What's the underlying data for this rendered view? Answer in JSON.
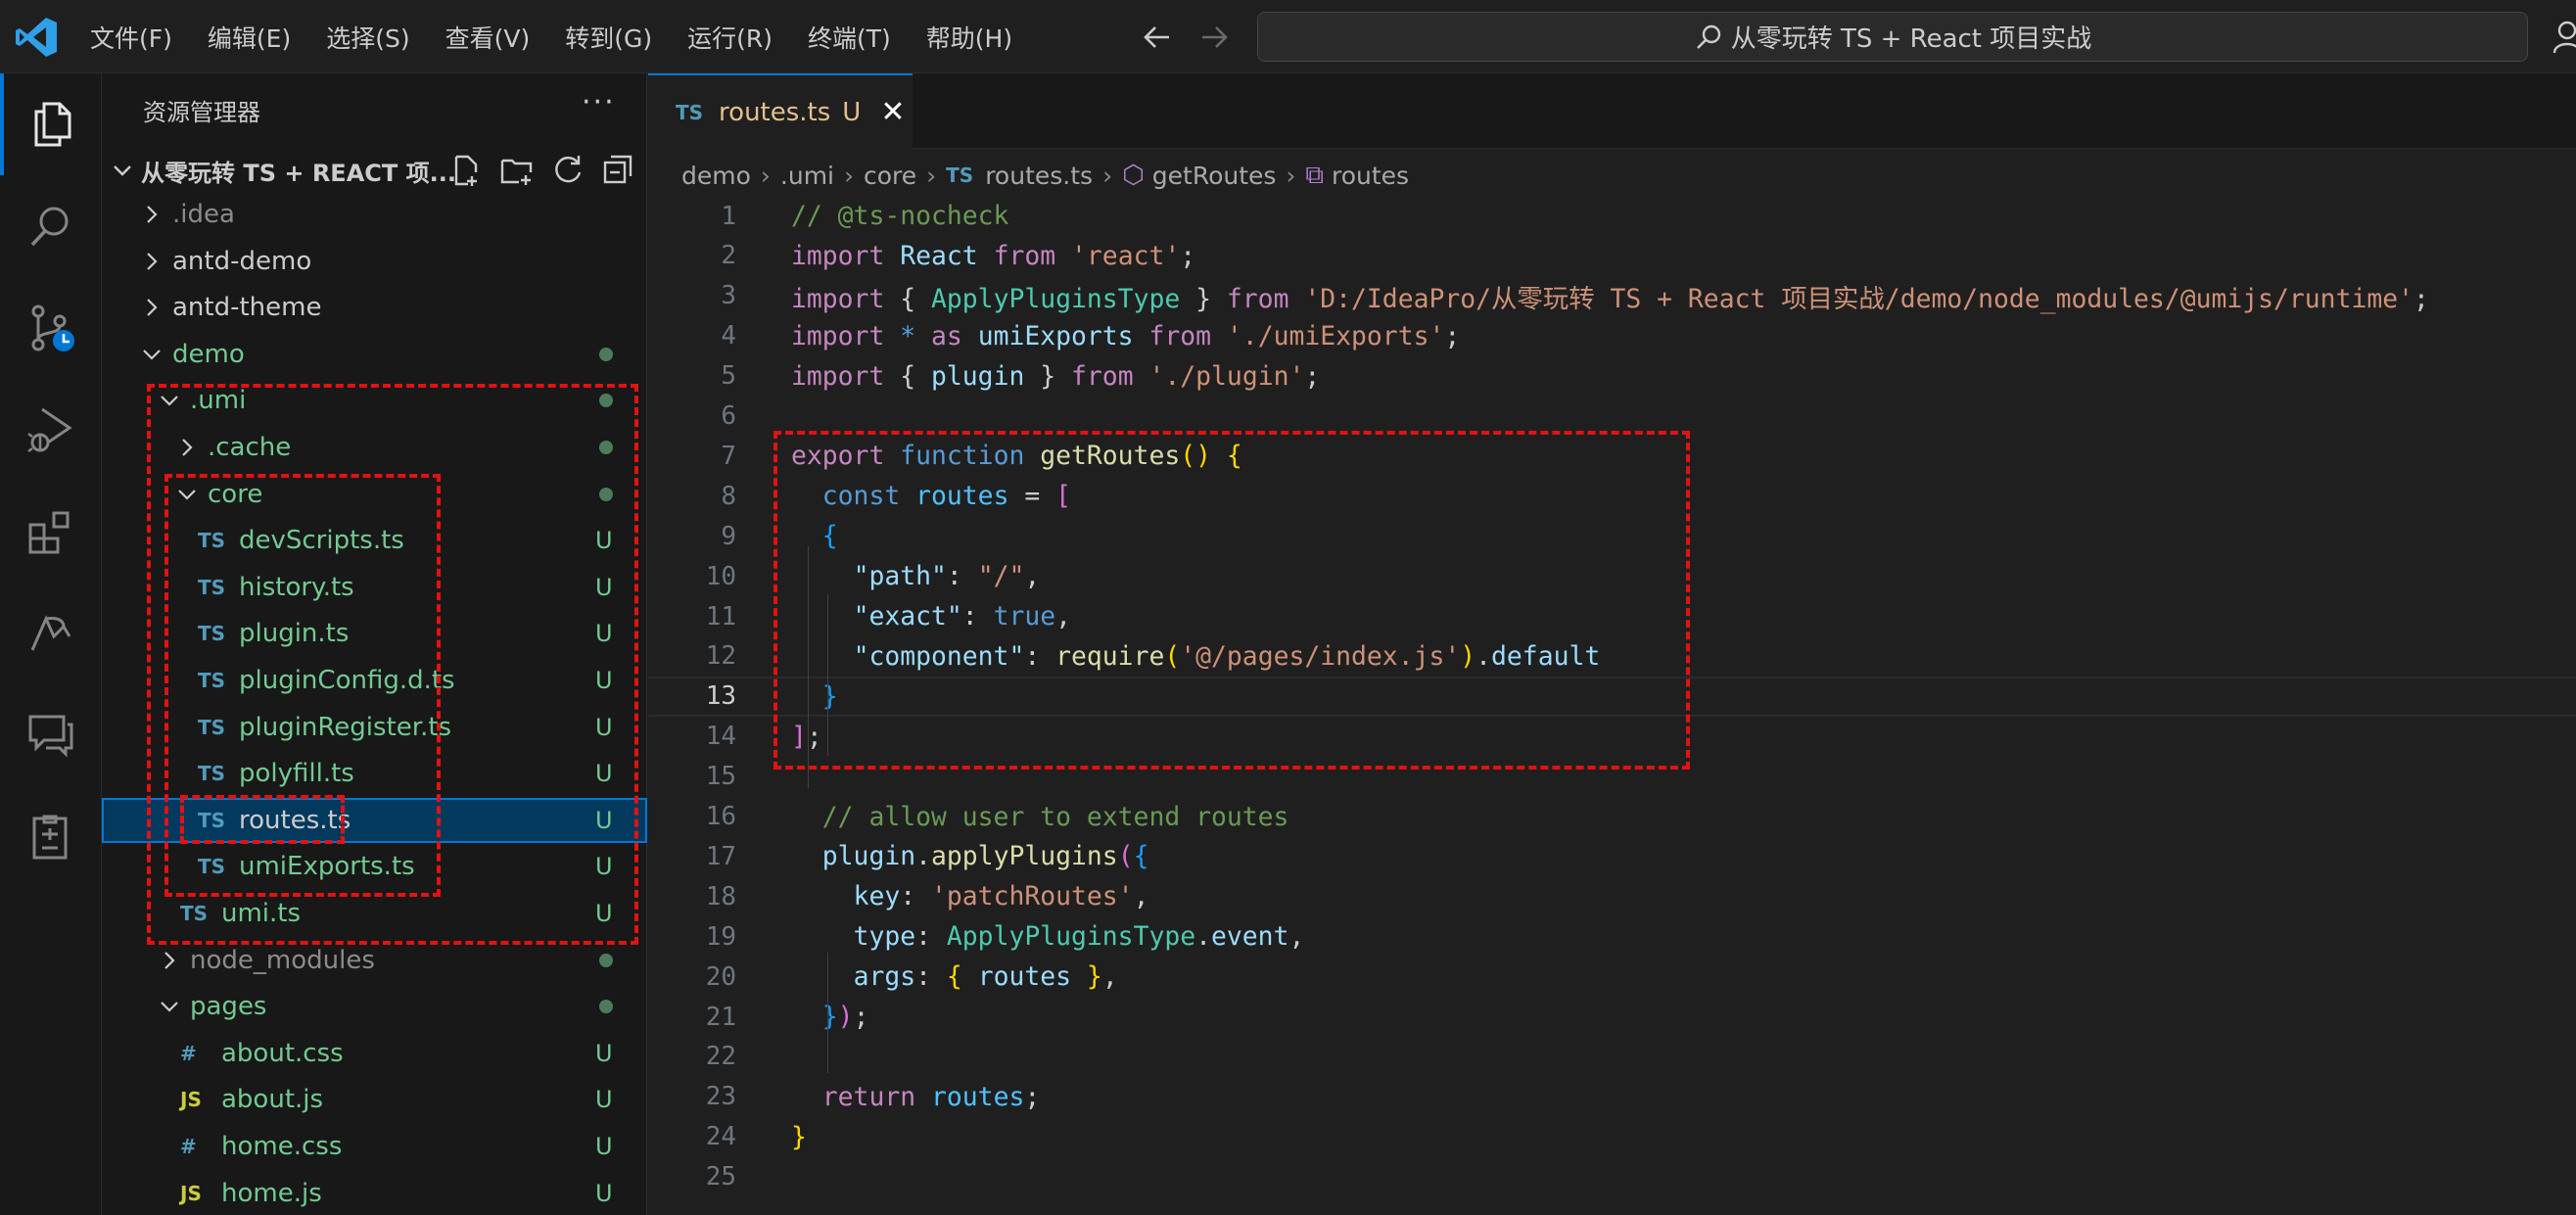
{
  "menu": [
    "文件(F)",
    "编辑(E)",
    "选择(S)",
    "查看(V)",
    "转到(G)",
    "运行(R)",
    "终端(T)",
    "帮助(H)"
  ],
  "search": {
    "text": "从零玩转 TS + React 项目实战"
  },
  "explorer": {
    "title": "资源管理器",
    "more": "···",
    "project": "从零玩转 TS + REACT 项...",
    "items": [
      {
        "name": ".idea",
        "type": "folder",
        "open": false,
        "indent": 0,
        "color": "grey",
        "status": ""
      },
      {
        "name": "antd-demo",
        "type": "folder",
        "open": false,
        "indent": 0,
        "color": "white",
        "status": ""
      },
      {
        "name": "antd-theme",
        "type": "folder",
        "open": false,
        "indent": 0,
        "color": "white",
        "status": ""
      },
      {
        "name": "demo",
        "type": "folder",
        "open": true,
        "indent": 0,
        "color": "green",
        "status": "dot"
      },
      {
        "name": ".umi",
        "type": "folder",
        "open": true,
        "indent": 1,
        "color": "green",
        "status": "dot"
      },
      {
        "name": ".cache",
        "type": "folder",
        "open": false,
        "indent": 2,
        "color": "green",
        "status": "dot"
      },
      {
        "name": "core",
        "type": "folder",
        "open": true,
        "indent": 2,
        "color": "green",
        "status": "dot"
      },
      {
        "name": "devScripts.ts",
        "type": "ts",
        "indent": 3,
        "color": "green",
        "status": "U"
      },
      {
        "name": "history.ts",
        "type": "ts",
        "indent": 3,
        "color": "green",
        "status": "U"
      },
      {
        "name": "plugin.ts",
        "type": "ts",
        "indent": 3,
        "color": "green",
        "status": "U"
      },
      {
        "name": "pluginConfig.d.ts",
        "type": "ts",
        "indent": 3,
        "color": "green",
        "status": "U"
      },
      {
        "name": "pluginRegister.ts",
        "type": "ts",
        "indent": 3,
        "color": "green",
        "status": "U"
      },
      {
        "name": "polyfill.ts",
        "type": "ts",
        "indent": 3,
        "color": "green",
        "status": "U"
      },
      {
        "name": "routes.ts",
        "type": "ts",
        "indent": 3,
        "color": "white",
        "status": "U",
        "selected": true
      },
      {
        "name": "umiExports.ts",
        "type": "ts",
        "indent": 3,
        "color": "green",
        "status": "U"
      },
      {
        "name": "umi.ts",
        "type": "ts",
        "indent": 2,
        "color": "green",
        "status": "U"
      },
      {
        "name": "node_modules",
        "type": "folder",
        "open": false,
        "indent": 1,
        "color": "grey",
        "status": "dot"
      },
      {
        "name": "pages",
        "type": "folder",
        "open": true,
        "indent": 1,
        "color": "green",
        "status": "dot"
      },
      {
        "name": "about.css",
        "type": "css",
        "indent": 2,
        "color": "green",
        "status": "U"
      },
      {
        "name": "about.js",
        "type": "js",
        "indent": 2,
        "color": "green",
        "status": "U"
      },
      {
        "name": "home.css",
        "type": "css",
        "indent": 2,
        "color": "green",
        "status": "U"
      },
      {
        "name": "home.js",
        "type": "js",
        "indent": 2,
        "color": "green",
        "status": "U"
      }
    ]
  },
  "tab": {
    "icon": "TS",
    "name": "routes.ts",
    "status": "U",
    "close": "✕"
  },
  "breadcrumb": [
    "demo",
    ".umi",
    "core",
    "routes.ts",
    "getRoutes",
    "routes"
  ],
  "code": [
    [
      [
        "cm",
        "// @ts-nocheck"
      ]
    ],
    [
      [
        "kc",
        "import "
      ],
      [
        "v",
        "React "
      ],
      [
        "kc",
        "from "
      ],
      [
        "s",
        "'react'"
      ],
      [
        "p",
        ";"
      ]
    ],
    [
      [
        "kc",
        "import "
      ],
      [
        "p",
        "{ "
      ],
      [
        "t",
        "ApplyPluginsType "
      ],
      [
        "p",
        "} "
      ],
      [
        "kc",
        "from "
      ],
      [
        "s",
        "'D:/IdeaPro/从零玩转 TS + React 项目实战/demo/node_modules/@umijs/runtime'"
      ],
      [
        "p",
        ";"
      ]
    ],
    [
      [
        "kc",
        "import "
      ],
      [
        "k",
        "* "
      ],
      [
        "kc",
        "as "
      ],
      [
        "v",
        "umiExports "
      ],
      [
        "kc",
        "from "
      ],
      [
        "s",
        "'./umiExports'"
      ],
      [
        "p",
        ";"
      ]
    ],
    [
      [
        "kc",
        "import "
      ],
      [
        "p",
        "{ "
      ],
      [
        "v",
        "plugin "
      ],
      [
        "p",
        "} "
      ],
      [
        "kc",
        "from "
      ],
      [
        "s",
        "'./plugin'"
      ],
      [
        "p",
        ";"
      ]
    ],
    [],
    [
      [
        "kc",
        "export "
      ],
      [
        "k",
        "function "
      ],
      [
        "f",
        "getRoutes"
      ],
      [
        "b1",
        "() {"
      ]
    ],
    [
      [
        "p",
        "  "
      ],
      [
        "k",
        "const "
      ],
      [
        "cn",
        "routes "
      ],
      [
        "p",
        "= "
      ],
      [
        "b2",
        "["
      ]
    ],
    [
      [
        "p",
        "  "
      ],
      [
        "b3",
        "{"
      ]
    ],
    [
      [
        "p",
        "    "
      ],
      [
        "v",
        "\"path\""
      ],
      [
        "p",
        ": "
      ],
      [
        "s",
        "\"/\""
      ],
      [
        "p",
        ","
      ]
    ],
    [
      [
        "p",
        "    "
      ],
      [
        "v",
        "\"exact\""
      ],
      [
        "p",
        ": "
      ],
      [
        "k",
        "true"
      ],
      [
        "p",
        ","
      ]
    ],
    [
      [
        "p",
        "    "
      ],
      [
        "v",
        "\"component\""
      ],
      [
        "p",
        ": "
      ],
      [
        "f",
        "require"
      ],
      [
        "b1",
        "("
      ],
      [
        "s",
        "'@/pages/index.js'"
      ],
      [
        "b1",
        ")"
      ],
      [
        "p",
        "."
      ],
      [
        "v",
        "default"
      ]
    ],
    [
      [
        "p",
        "  "
      ],
      [
        "b3",
        "}"
      ]
    ],
    [
      [
        "b2",
        "]"
      ],
      [
        "p",
        ";"
      ]
    ],
    [],
    [
      [
        "p",
        "  "
      ],
      [
        "cm",
        "// allow user to extend routes"
      ]
    ],
    [
      [
        "p",
        "  "
      ],
      [
        "v",
        "plugin"
      ],
      [
        "p",
        "."
      ],
      [
        "f",
        "applyPlugins"
      ],
      [
        "b2",
        "("
      ],
      [
        "b3",
        "{"
      ]
    ],
    [
      [
        "p",
        "    "
      ],
      [
        "v",
        "key"
      ],
      [
        "p",
        ": "
      ],
      [
        "s",
        "'patchRoutes'"
      ],
      [
        "p",
        ","
      ]
    ],
    [
      [
        "p",
        "    "
      ],
      [
        "v",
        "type"
      ],
      [
        "p",
        ": "
      ],
      [
        "t",
        "ApplyPluginsType"
      ],
      [
        "p",
        "."
      ],
      [
        "v",
        "event"
      ],
      [
        "p",
        ","
      ]
    ],
    [
      [
        "p",
        "    "
      ],
      [
        "v",
        "args"
      ],
      [
        "p",
        ": "
      ],
      [
        "b1",
        "{ "
      ],
      [
        "v",
        "routes "
      ],
      [
        "b1",
        "}"
      ],
      [
        "p",
        ","
      ]
    ],
    [
      [
        "p",
        "  "
      ],
      [
        "b3",
        "}"
      ],
      [
        "b2",
        ")"
      ],
      [
        "p",
        ";"
      ]
    ],
    [],
    [
      [
        "p",
        "  "
      ],
      [
        "kc",
        "return "
      ],
      [
        "cn",
        "routes"
      ],
      [
        "p",
        ";"
      ]
    ],
    [
      [
        "b1",
        "}"
      ]
    ],
    []
  ],
  "current_line": 13,
  "colors": {
    "accent": "#0078d4",
    "annotation": "#e21212",
    "untracked": "#73c991"
  }
}
